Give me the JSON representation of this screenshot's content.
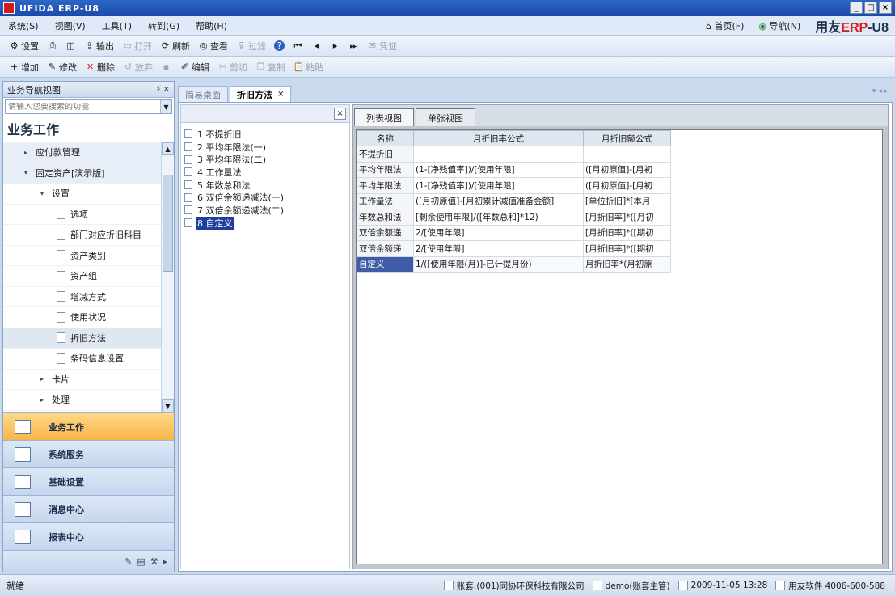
{
  "window": {
    "title": "UFIDA ERP-U8",
    "min": "_",
    "max": "□",
    "close": "×"
  },
  "menubar": {
    "items": [
      "系统(S)",
      "视图(V)",
      "工具(T)",
      "转到(G)",
      "帮助(H)"
    ],
    "home": "首页(F)",
    "nav": "导航(N)",
    "brand_prefix": "用友",
    "brand_erp": "ERP",
    "brand_suffix": "-U8"
  },
  "toolbar1": [
    {
      "label": "设置",
      "icon": "settings-icon",
      "disabled": false
    },
    {
      "label": "",
      "icon": "print-icon",
      "disabled": false
    },
    {
      "label": "",
      "icon": "preview-icon",
      "disabled": false
    },
    {
      "label": "输出",
      "icon": "export-icon",
      "disabled": false
    },
    {
      "label": "打开",
      "icon": "open-icon",
      "disabled": true
    },
    {
      "label": "刷新",
      "icon": "refresh-icon",
      "disabled": false
    },
    {
      "label": "查看",
      "icon": "view-icon",
      "disabled": false
    },
    {
      "label": "过滤",
      "icon": "filter-icon",
      "disabled": true
    },
    {
      "label": "",
      "icon": "help-icon",
      "disabled": false
    },
    {
      "label": "",
      "icon": "first-icon",
      "disabled": false
    },
    {
      "label": "",
      "icon": "prev-icon",
      "disabled": false
    },
    {
      "label": "",
      "icon": "next-icon",
      "disabled": false
    },
    {
      "label": "",
      "icon": "last-icon",
      "disabled": false
    },
    {
      "label": "凭证",
      "icon": "voucher-icon",
      "disabled": true
    }
  ],
  "toolbar2": [
    {
      "label": "增加",
      "icon": "add-icon",
      "disabled": false
    },
    {
      "label": "修改",
      "icon": "edit-icon",
      "disabled": false
    },
    {
      "label": "删除",
      "icon": "delete-icon",
      "disabled": false
    },
    {
      "label": "放弃",
      "icon": "discard-icon",
      "disabled": true
    },
    {
      "label": "",
      "icon": "save-icon",
      "disabled": true
    },
    {
      "label": "编辑",
      "icon": "editmode-icon",
      "disabled": false
    },
    {
      "label": "剪切",
      "icon": "cut-icon",
      "disabled": true
    },
    {
      "label": "复制",
      "icon": "copy-icon",
      "disabled": true
    },
    {
      "label": "粘贴",
      "icon": "paste-icon",
      "disabled": true
    }
  ],
  "nav": {
    "header": "业务导航视图",
    "pin": "♯ ×",
    "search_placeholder": "请输入您要搜索的功能",
    "section": "业务工作",
    "tree": [
      {
        "label": "应付款管理",
        "level": 1,
        "arrow": "▸"
      },
      {
        "label": "固定资产[演示版]",
        "level": 1,
        "arrow": "▾"
      },
      {
        "label": "设置",
        "level": 2,
        "arrow": "▾"
      },
      {
        "label": "选项",
        "level": 3
      },
      {
        "label": "部门对应折旧科目",
        "level": 3
      },
      {
        "label": "资产类别",
        "level": 3
      },
      {
        "label": "资产组",
        "level": 3
      },
      {
        "label": "增减方式",
        "level": 3
      },
      {
        "label": "使用状况",
        "level": 3
      },
      {
        "label": "折旧方法",
        "level": 3,
        "selected": true
      },
      {
        "label": "条码信息设置",
        "level": 3
      },
      {
        "label": "卡片",
        "level": 2,
        "arrow": "▸"
      },
      {
        "label": "处理",
        "level": 2,
        "arrow": "▸"
      }
    ],
    "buttons": [
      {
        "label": "业务工作",
        "active": true
      },
      {
        "label": "系统服务",
        "active": false
      },
      {
        "label": "基础设置",
        "active": false
      },
      {
        "label": "消息中心",
        "active": false
      },
      {
        "label": "报表中心",
        "active": false
      }
    ]
  },
  "tabs": [
    {
      "label": "简易桌面",
      "active": false
    },
    {
      "label": "折旧方法",
      "active": true
    }
  ],
  "methods": [
    "1 不提折旧",
    "2 平均年限法(一)",
    "3 平均年限法(二)",
    "4 工作量法",
    "5 年数总和法",
    "6 双倍余额递减法(一)",
    "7 双倍余额递减法(二)",
    "8 自定义"
  ],
  "viewtabs": [
    "列表视图",
    "单张视图"
  ],
  "grid": {
    "columns": [
      "名称",
      "月折旧率公式",
      "月折旧额公式"
    ],
    "rows": [
      [
        "不提折旧",
        "",
        ""
      ],
      [
        "平均年限法",
        "(1-[净残值率])/[使用年限]",
        "([月初原值]-[月初"
      ],
      [
        "平均年限法",
        "(1-[净残值率])/[使用年限]",
        "([月初原值]-[月初"
      ],
      [
        "工作量法",
        "([月初原值]-[月初累计减值准备金额]",
        "[单位折旧]*[本月"
      ],
      [
        "年数总和法",
        "[剩余使用年限]/([年数总和]*12)",
        "[月折旧率]*([月初"
      ],
      [
        "双倍余额递",
        "2/[使用年限]",
        "[月折旧率]*([期初"
      ],
      [
        "双倍余额递",
        "2/[使用年限]",
        "[月折旧率]*([期初"
      ],
      [
        "自定义",
        "1/([使用年限(月)]-已计提月份)",
        "月折旧率*(月初原"
      ]
    ]
  },
  "status": {
    "left": "就绪",
    "account": "账套:(001)同协环保科技有限公司",
    "user": "demo(账套主管)",
    "datetime": "2009-11-05 13:28",
    "company": "用友软件 4006-600-588"
  }
}
